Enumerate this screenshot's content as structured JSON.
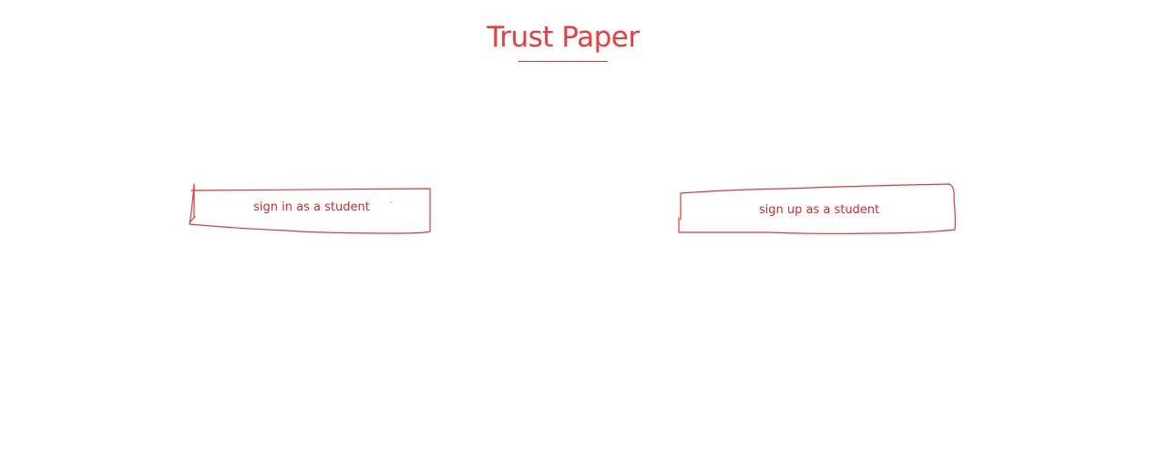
{
  "header": {
    "title": "Trust Paper"
  },
  "actions": {
    "sign_in_label": "sign in as a student",
    "sign_up_label": "sign up as a student"
  },
  "colors": {
    "accent": "#e23636",
    "background": "#ffffff"
  }
}
